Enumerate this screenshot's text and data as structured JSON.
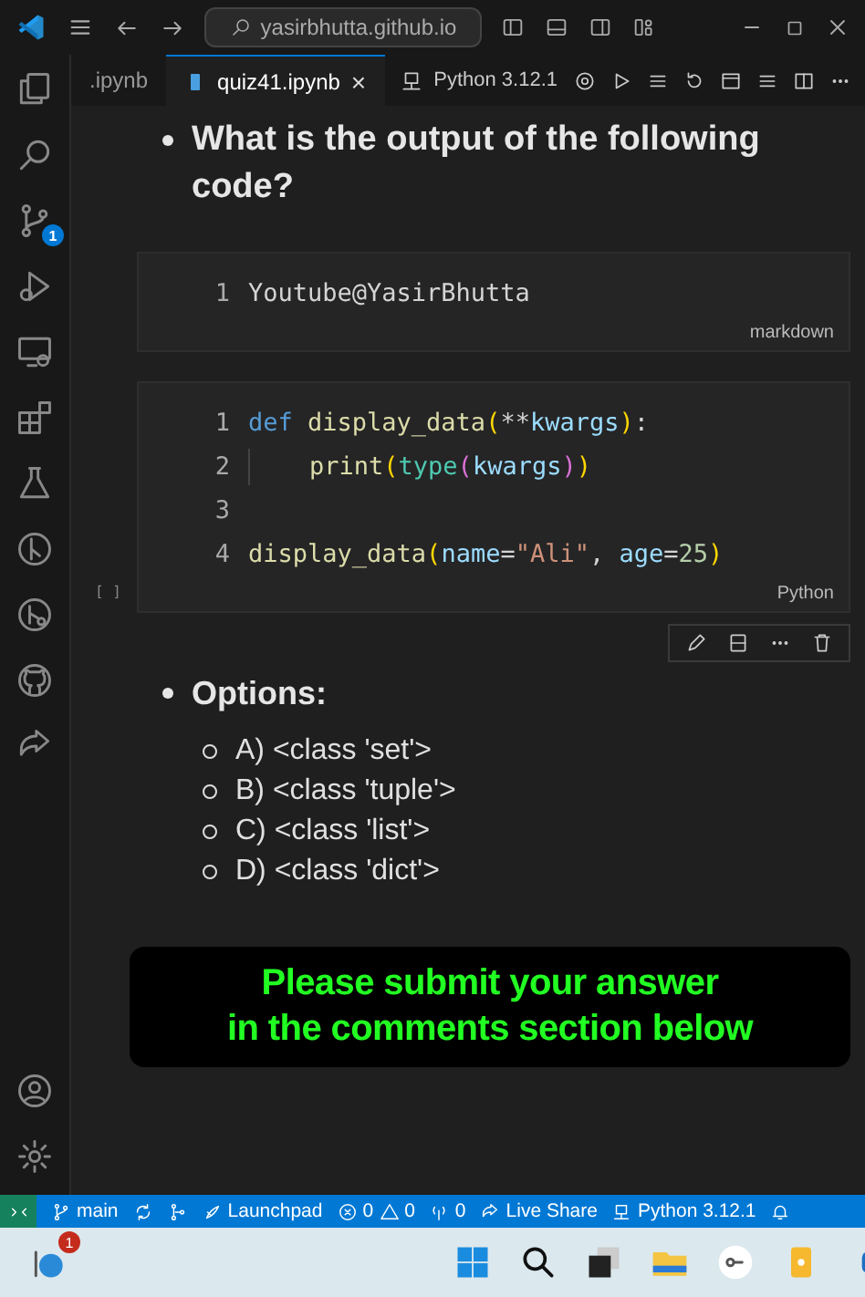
{
  "title_bar": {
    "search": "yasirbhutta.github.io"
  },
  "tabs": [
    {
      "label": ".ipynb",
      "selected": false
    },
    {
      "label": "quiz41.ipynb",
      "selected": true,
      "close": "×"
    }
  ],
  "kernel": {
    "label": "Python 3.12.1"
  },
  "activity_bar": {
    "source_control_badge": "1"
  },
  "question": {
    "text": "What is the output of the following code?"
  },
  "markdown_cell": {
    "lines": [
      {
        "number": "1",
        "tokens": [
          {
            "kind": "plain",
            "text": "Youtube@YasirBhutta"
          }
        ]
      }
    ],
    "language": "markdown"
  },
  "code_cell": {
    "run_marker": "[ ]",
    "language": "Python",
    "lines": [
      {
        "number": "1",
        "tokens": [
          {
            "kind": "keyword",
            "text": "def "
          },
          {
            "kind": "func",
            "text": "display_data"
          },
          {
            "kind": "bracket",
            "text": "("
          },
          {
            "kind": "plain",
            "text": "**"
          },
          {
            "kind": "param",
            "text": "kwargs"
          },
          {
            "kind": "bracket",
            "text": ")"
          },
          {
            "kind": "plain",
            "text": ":"
          }
        ]
      },
      {
        "number": "2",
        "indent": true,
        "tokens": [
          {
            "kind": "func",
            "text": "print"
          },
          {
            "kind": "bracket",
            "text": "("
          },
          {
            "kind": "builtin",
            "text": "type"
          },
          {
            "kind": "bracket2",
            "text": "("
          },
          {
            "kind": "param",
            "text": "kwargs"
          },
          {
            "kind": "bracket2",
            "text": ")"
          },
          {
            "kind": "bracket",
            "text": ")"
          }
        ]
      },
      {
        "number": "3"
      },
      {
        "number": "4",
        "tokens": [
          {
            "kind": "func",
            "text": "display_data"
          },
          {
            "kind": "bracket",
            "text": "("
          },
          {
            "kind": "param",
            "text": "name"
          },
          {
            "kind": "plain",
            "text": "="
          },
          {
            "kind": "string",
            "text": "\"Ali\""
          },
          {
            "kind": "plain",
            "text": ", "
          },
          {
            "kind": "param",
            "text": "age"
          },
          {
            "kind": "plain",
            "text": "="
          },
          {
            "kind": "number",
            "text": "25"
          },
          {
            "kind": "bracket",
            "text": ")"
          }
        ]
      }
    ]
  },
  "options": {
    "heading": "Options:",
    "items": [
      "A) <class 'set'>",
      "B) <class 'tuple'>",
      "C) <class 'list'>",
      "D) <class 'dict'>"
    ]
  },
  "banner": {
    "lines": [
      "Please submit your answer",
      "in the comments section below"
    ]
  },
  "status_bar": {
    "branch": "main",
    "launchpad": "Launchpad",
    "errors": "0",
    "warnings": "0",
    "ports": "0",
    "live_share": "Live Share",
    "python": "Python 3.12.1"
  },
  "taskbar": {
    "notification_badge": "1"
  }
}
